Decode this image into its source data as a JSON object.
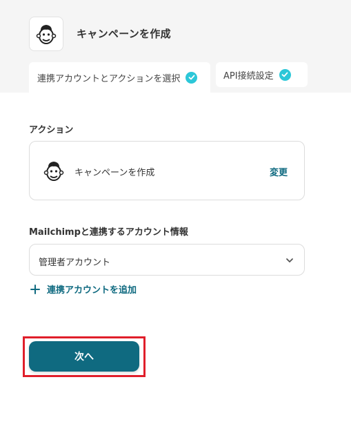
{
  "header": {
    "title": "キャンペーンを作成",
    "app_icon": "mailchimp-logo"
  },
  "tabs": [
    {
      "label": "連携アカウントとアクションを選択",
      "completed": true,
      "active": true
    },
    {
      "label": "API接続設定",
      "completed": true,
      "active": false
    }
  ],
  "action_section": {
    "label": "アクション",
    "card_text": "キャンペーンを作成",
    "change_label": "変更"
  },
  "account_section": {
    "label": "Mailchimpと連携するアカウント情報",
    "selected_value": "管理者アカウント",
    "add_label": "連携アカウントを追加"
  },
  "footer": {
    "next_label": "次へ",
    "highlight_color": "#e01e2a"
  },
  "colors": {
    "accent": "#0f6a80",
    "check": "#2cc7d8"
  }
}
